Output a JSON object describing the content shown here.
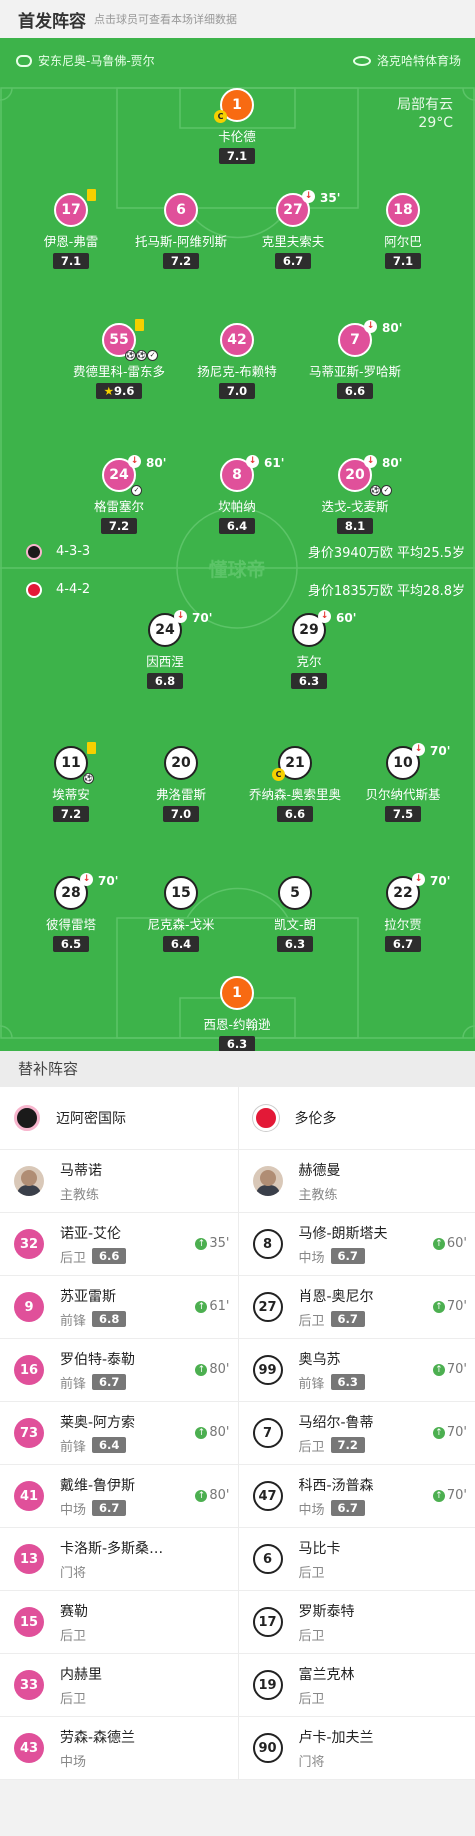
{
  "header": {
    "title": "首发阵容",
    "subtitle": "点击球员可查看本场详细数据"
  },
  "match": {
    "referee": "安东尼奥-马鲁佛-贾尔",
    "venue": "洛克哈特体育场",
    "weather": "局部有云",
    "temperature": "29°C",
    "watermark": "懂球帝"
  },
  "home_team": {
    "name": "迈阿密国际",
    "formation": "4-3-3",
    "value_info": "身价3940万欧 平均25.5岁"
  },
  "away_team": {
    "name": "多伦多",
    "formation": "4-4-2",
    "value_info": "身价1835万欧 平均28.8岁"
  },
  "home_players": [
    {
      "num": "1",
      "name": "卡伦德",
      "rating": "7.1"
    },
    {
      "num": "17",
      "name": "伊恩-弗雷",
      "rating": "7.1"
    },
    {
      "num": "6",
      "name": "托马斯-阿维列斯",
      "rating": "7.2"
    },
    {
      "num": "27",
      "name": "克里夫索夫",
      "rating": "6.7",
      "sub": "35'"
    },
    {
      "num": "18",
      "name": "阿尔巴",
      "rating": "7.1"
    },
    {
      "num": "55",
      "name": "费德里科-雷东多",
      "rating": "9.6"
    },
    {
      "num": "42",
      "name": "扬尼克-布赖特",
      "rating": "7.0"
    },
    {
      "num": "7",
      "name": "马蒂亚斯-罗哈斯",
      "rating": "6.6",
      "sub": "80'"
    },
    {
      "num": "24",
      "name": "格雷塞尔",
      "rating": "7.2",
      "sub": "80'"
    },
    {
      "num": "8",
      "name": "坎帕纳",
      "rating": "6.4",
      "sub": "61'"
    },
    {
      "num": "20",
      "name": "迭戈-戈麦斯",
      "rating": "8.1",
      "sub": "80'"
    }
  ],
  "away_players": [
    {
      "num": "24",
      "name": "因西涅",
      "rating": "6.8",
      "sub": "70'"
    },
    {
      "num": "29",
      "name": "克尔",
      "rating": "6.3",
      "sub": "60'"
    },
    {
      "num": "11",
      "name": "埃蒂安",
      "rating": "7.2"
    },
    {
      "num": "20",
      "name": "弗洛雷斯",
      "rating": "7.0"
    },
    {
      "num": "21",
      "name": "乔纳森-奥索里奥",
      "rating": "6.6"
    },
    {
      "num": "10",
      "name": "贝尔纳代斯基",
      "rating": "7.5",
      "sub": "70'"
    },
    {
      "num": "28",
      "name": "彼得雷塔",
      "rating": "6.5",
      "sub": "70'"
    },
    {
      "num": "15",
      "name": "尼克森-戈米",
      "rating": "6.4"
    },
    {
      "num": "5",
      "name": "凯文-朗",
      "rating": "6.3"
    },
    {
      "num": "22",
      "name": "拉尔贾",
      "rating": "6.7",
      "sub": "70'"
    },
    {
      "num": "1",
      "name": "西恩-约翰逊",
      "rating": "6.3"
    }
  ],
  "subs_section": {
    "title": "替补阵容",
    "coach_label": "主教练",
    "home_coach": "马蒂诺",
    "away_coach": "赫德曼",
    "home": [
      {
        "num": "32",
        "name": "诺亚-艾伦",
        "pos": "后卫",
        "rating": "6.6",
        "on": "35'"
      },
      {
        "num": "9",
        "name": "苏亚雷斯",
        "pos": "前锋",
        "rating": "6.8",
        "on": "61'"
      },
      {
        "num": "16",
        "name": "罗伯特-泰勒",
        "pos": "前锋",
        "rating": "6.7",
        "on": "80'"
      },
      {
        "num": "73",
        "name": "莱奥-阿方索",
        "pos": "前锋",
        "rating": "6.4",
        "on": "80'"
      },
      {
        "num": "41",
        "name": "戴维-鲁伊斯",
        "pos": "中场",
        "rating": "6.7",
        "on": "80'"
      },
      {
        "num": "13",
        "name": "卡洛斯-多斯桑托斯",
        "pos": "门将"
      },
      {
        "num": "15",
        "name": "赛勒",
        "pos": "后卫"
      },
      {
        "num": "33",
        "name": "内赫里",
        "pos": "后卫"
      },
      {
        "num": "43",
        "name": "劳森-森德兰",
        "pos": "中场"
      }
    ],
    "away": [
      {
        "num": "8",
        "name": "马修-朗斯塔夫",
        "pos": "中场",
        "rating": "6.7",
        "on": "60'"
      },
      {
        "num": "27",
        "name": "肖恩-奥尼尔",
        "pos": "后卫",
        "rating": "6.7",
        "on": "70'"
      },
      {
        "num": "99",
        "name": "奥乌苏",
        "pos": "前锋",
        "rating": "6.3",
        "on": "70'"
      },
      {
        "num": "7",
        "name": "马绍尔-鲁蒂",
        "pos": "后卫",
        "rating": "7.2",
        "on": "70'"
      },
      {
        "num": "47",
        "name": "科西-汤普森",
        "pos": "中场",
        "rating": "6.7",
        "on": "70'"
      },
      {
        "num": "6",
        "name": "马比卡",
        "pos": "后卫"
      },
      {
        "num": "17",
        "name": "罗斯泰特",
        "pos": "后卫"
      },
      {
        "num": "19",
        "name": "富兰克林",
        "pos": "后卫"
      },
      {
        "num": "90",
        "name": "卢卡-加夫兰",
        "pos": "门将"
      }
    ]
  },
  "colors": {
    "pitch": "#3db34a",
    "home": "#e0509a",
    "keeper": "#f86a12",
    "away": "#ffffff"
  }
}
